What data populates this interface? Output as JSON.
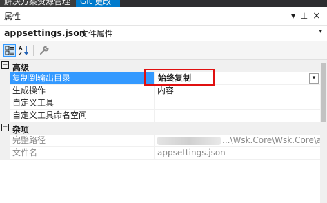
{
  "tabs": [
    {
      "label": "解决方案资源管理器"
    },
    {
      "label": "Git 更改"
    }
  ],
  "panel": {
    "title": "属性",
    "dropdown_glyph": "▾",
    "pin_glyph": "⊥",
    "close_glyph": "×"
  },
  "object_selector": {
    "name": "appsettings.json",
    "type": "文件属性",
    "chevron": "▾"
  },
  "toolbar": {
    "categorized_tooltip": "按分类顺序",
    "alphabetical_tooltip": "按字母顺序",
    "property_pages_tooltip": "属性页"
  },
  "categories": {
    "advanced": {
      "expand_glyph": "−",
      "label": "高级"
    },
    "misc": {
      "expand_glyph": "−",
      "label": "杂项"
    }
  },
  "properties": {
    "copy_to_output": {
      "name": "复制到输出目录",
      "value": "始终复制"
    },
    "build_action": {
      "name": "生成操作",
      "value": "内容"
    },
    "custom_tool": {
      "name": "自定义工具",
      "value": ""
    },
    "custom_tool_ns": {
      "name": "自定义工具命名空间",
      "value": ""
    },
    "full_path": {
      "name": "完整路径",
      "value": "...\\Wsk.Core\\Wsk.Core\\appset"
    },
    "file_name": {
      "name": "文件名",
      "value": "appsettings.json"
    }
  },
  "dropdown_glyph": "▾",
  "colors": {
    "selection": "#3399ff",
    "highlight_box": "#e01010",
    "category_bg": "#f0f0f0"
  }
}
